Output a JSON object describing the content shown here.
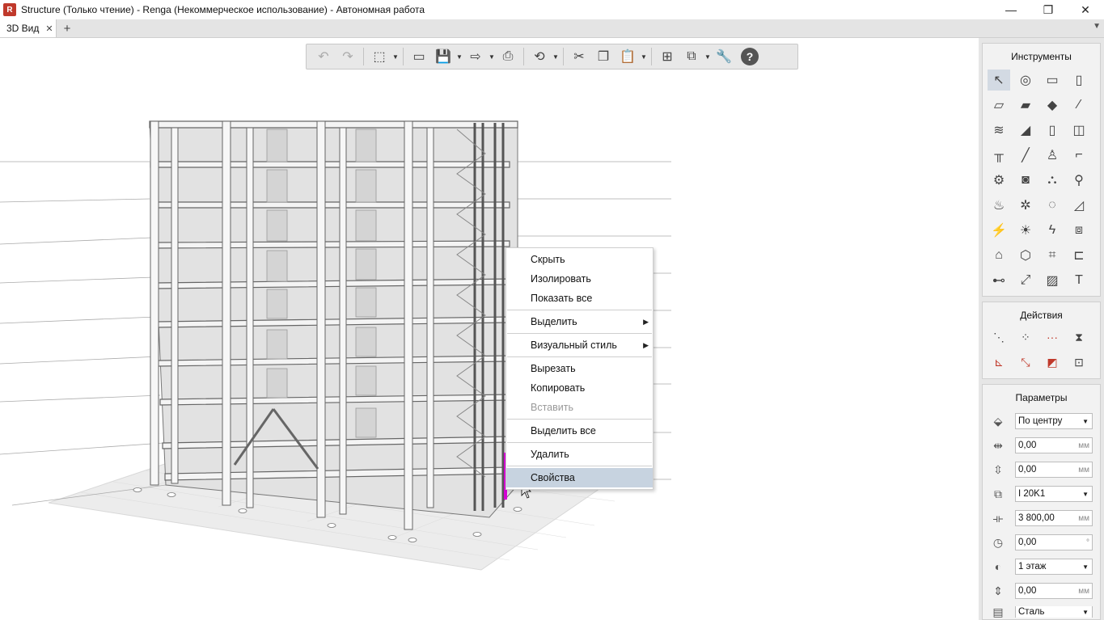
{
  "window": {
    "title": "Structure (Только чтение) - Renga (Некоммерческое использование) - Автономная работа",
    "minimize": "—",
    "restore": "❐",
    "close": "✕"
  },
  "tabs": {
    "active_label": "3D Вид",
    "close_glyph": "✕",
    "add_glyph": "+",
    "menu_glyph": "▼"
  },
  "toolbar": {
    "undo": "↶",
    "redo": "↷",
    "view": "⬚",
    "open": "▭",
    "save": "💾",
    "export": "⇨",
    "print": "⎙",
    "sync": "⟲",
    "cut": "✂",
    "copy": "❐",
    "paste": "📋",
    "structure": "⊞",
    "layers": "⧉",
    "settings": "🔧",
    "help": "?",
    "drop": "▼"
  },
  "context_menu": {
    "hide": "Скрыть",
    "isolate": "Изолировать",
    "show_all": "Показать все",
    "select": "Выделить",
    "visual_style": "Визуальный стиль",
    "cut": "Вырезать",
    "copy": "Копировать",
    "paste": "Вставить",
    "select_all": "Выделить все",
    "delete": "Удалить",
    "properties": "Свойства",
    "arrow": "▶"
  },
  "panels": {
    "tools_title": "Инструменты",
    "actions_title": "Действия",
    "params_title": "Параметры"
  },
  "params": {
    "alignment": "По центру",
    "offset_x": "0,00",
    "offset_y": "0,00",
    "profile": "I 20K1",
    "length": "3 800,00",
    "rotation": "0,00",
    "level": "1 этаж",
    "elevation": "0,00",
    "material": "Сталь",
    "unit_mm": "мм",
    "unit_deg": "°",
    "drop": "▼"
  }
}
